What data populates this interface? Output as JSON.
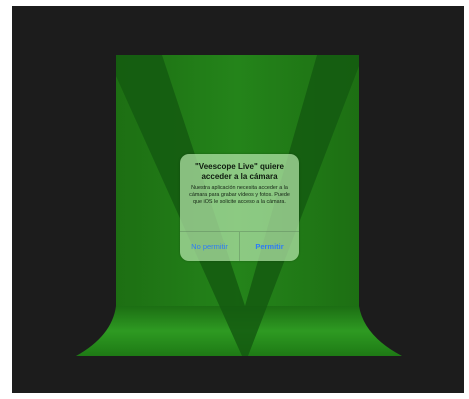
{
  "permission_alert": {
    "title": "\"Veescope Live\" quiere acceder a la cámara",
    "message": "Nuestra aplicación necesita acceder a la cámara para grabar vídeos y fotos. Puede que iOS le solicite acceso a la cámara.",
    "deny_label": "No permitir",
    "allow_label": "Permitir"
  },
  "colors": {
    "background": "#1c1c1c",
    "backdrop_green": "#1f7a14",
    "logo_dark_green": "#145a10",
    "alert_button_blue": "#2f7cf6"
  }
}
